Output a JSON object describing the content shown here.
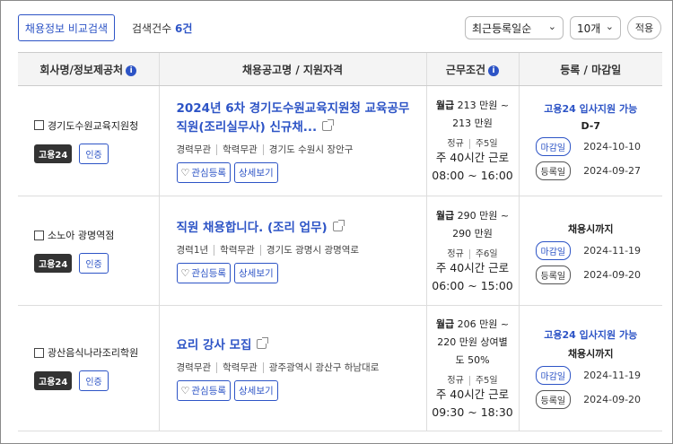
{
  "toolbar": {
    "compare_label": "채용정보 비교검색",
    "count_label": "검색건수",
    "count_value": "6건",
    "sort_value": "최근등록일순",
    "per_page_value": "10개",
    "apply_label": "적용"
  },
  "table": {
    "headers": [
      "회사명/정보제공처",
      "채용공고명 / 지원자격",
      "근무조건",
      "등록 / 마감일"
    ],
    "tag_source": "고용24",
    "tag_cert": "인증",
    "btn_interest": "관심등록",
    "btn_detail": "상세보기",
    "label_deadline": "마감일",
    "label_registered": "등록일",
    "rows": [
      {
        "company": "경기도수원교육지원청",
        "title": "2024년 6차 경기도수원교육지원청 교육공무직원(조리실무사) 신규채...",
        "career": "경력무관",
        "education": "학력무관",
        "location": "경기도 수원시 장안구",
        "pay_prefix": "월급",
        "pay_line1": "213 만원 ~",
        "pay_line2": "213 만원",
        "pay_line3": "",
        "type": "정규",
        "days": "주5일",
        "hours1": "주 40시간 근로",
        "hours2": "08:00 ~ 16:00",
        "apply": "고용24 입사지원 가능",
        "status": "D-7",
        "deadline": "2024-10-10",
        "registered": "2024-09-27"
      },
      {
        "company": "소노아 광명역점",
        "title": "직원 채용합니다. (조리 업무)",
        "career": "경력1년",
        "education": "학력무관",
        "location": "경기도 광명시 광명역로",
        "pay_prefix": "월급",
        "pay_line1": "290 만원 ~",
        "pay_line2": "290 만원",
        "pay_line3": "",
        "type": "정규",
        "days": "주6일",
        "hours1": "주 40시간 근로",
        "hours2": "06:00 ~ 15:00",
        "apply": "",
        "status": "채용시까지",
        "deadline": "2024-11-19",
        "registered": "2024-09-20"
      },
      {
        "company": "광산음식나라조리학원",
        "title": "요리 강사 모집",
        "career": "경력무관",
        "education": "학력무관",
        "location": "광주광역시 광산구 하남대로",
        "pay_prefix": "월급",
        "pay_line1": "206 만원 ~",
        "pay_line2": "220 만원 상여별",
        "pay_line3": "도 50%",
        "type": "정규",
        "days": "주5일",
        "hours1": "주 40시간 근로",
        "hours2": "09:30 ~ 18:30",
        "apply": "고용24 입사지원 가능",
        "status": "채용시까지",
        "deadline": "2024-11-19",
        "registered": "2024-09-20"
      }
    ]
  }
}
